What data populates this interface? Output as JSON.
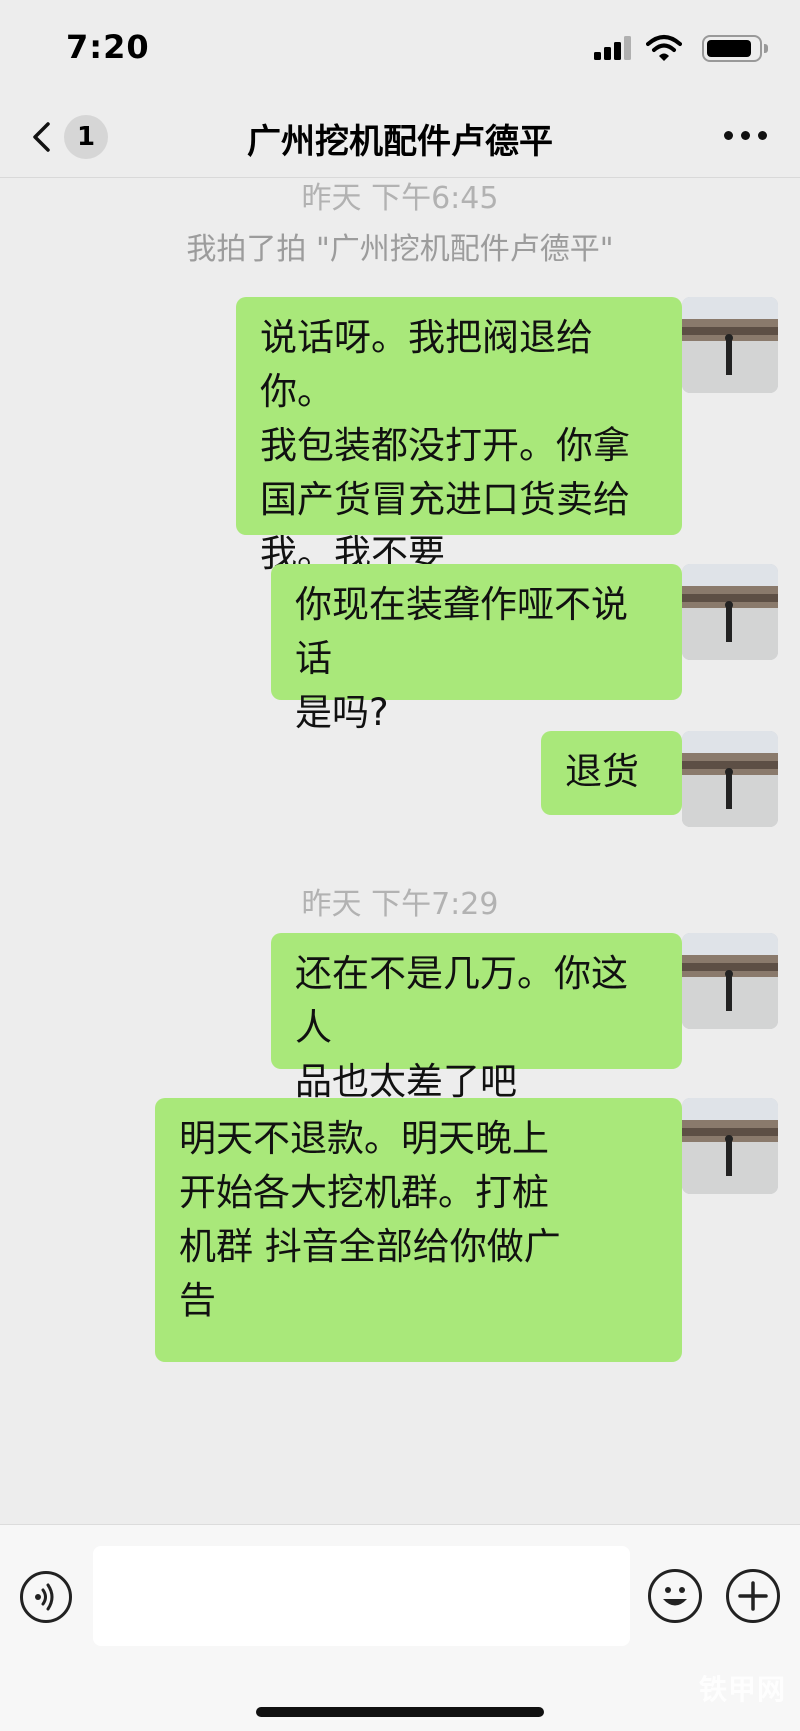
{
  "status_bar": {
    "time": "7:20"
  },
  "nav": {
    "back_icon": "chevron-left-icon",
    "unread_count": "1",
    "title": "广州挖机配件卢德平",
    "more_icon": "more-dots-icon"
  },
  "chat": {
    "timestamps": [
      "昨天 下午6:45",
      "昨天 下午7:29"
    ],
    "notice": "我拍了拍 \"广州挖机配件卢德平\"",
    "messages": [
      {
        "text": "说话呀。我把阀退给你。\n我包装都没打开。你拿\n国产货冒充进口货卖给\n我。我不要"
      },
      {
        "text": "你现在装聋作哑不说话\n是吗?"
      },
      {
        "text": "退货"
      },
      {
        "text": "还在不是几万。你这人\n品也太差了吧"
      },
      {
        "text": "明天不退款。明天晚上\n开始各大挖机群。打桩\n机群 抖音全部给你做广\n告"
      }
    ]
  },
  "input_bar": {
    "voice_icon": "voice-icon",
    "input_value": "",
    "emoji_icon": "emoji-icon",
    "plus_icon": "plus-icon"
  },
  "watermark": "铁甲网",
  "colors": {
    "bubble": "#a9e87a",
    "background": "#ededed"
  }
}
